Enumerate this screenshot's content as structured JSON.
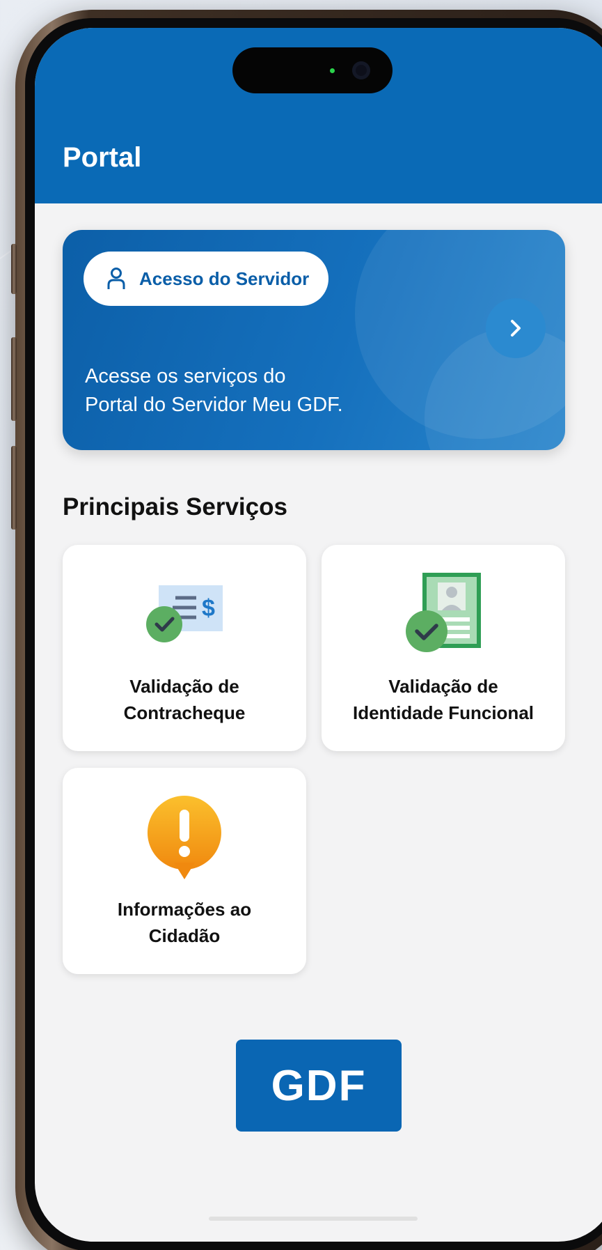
{
  "header": {
    "title": "Portal"
  },
  "hero": {
    "button_label": "Acesso do Servidor",
    "button_icon": "user-icon",
    "next_icon": "chevron-right-icon",
    "description_line1": "Acesse os serviços do",
    "description_line2": "Portal do Servidor Meu GDF."
  },
  "services": {
    "section_title": "Principais Serviços",
    "items": [
      {
        "line1": "Validação de",
        "line2": "Contracheque",
        "icon": "payslip-check-icon"
      },
      {
        "line1": "Validação de",
        "line2": "Identidade Funcional",
        "icon": "id-card-check-icon"
      },
      {
        "line1": "Informações ao",
        "line2": "Cidadão",
        "icon": "alert-info-icon"
      }
    ]
  },
  "footer": {
    "logo_text": "GDF"
  },
  "colors": {
    "primary": "#0a6ab6",
    "background": "#f3f3f4",
    "check_green": "#5cae62",
    "alert_orange": "#f7a21b"
  }
}
